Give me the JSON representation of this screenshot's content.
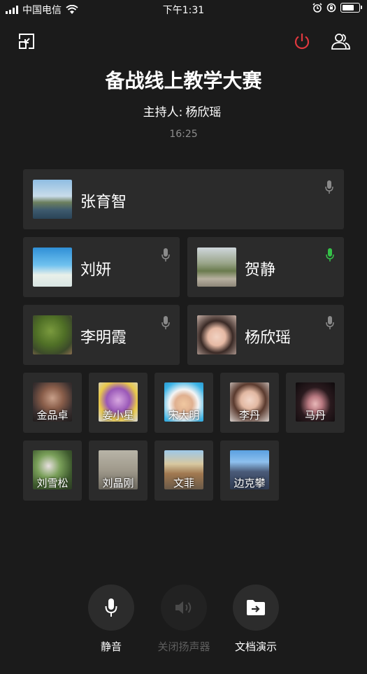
{
  "status_bar": {
    "carrier": "中国电信",
    "time": "下午1:31"
  },
  "meeting": {
    "title": "备战线上教学大赛",
    "host_label": "主持人:",
    "host_name": "杨欣瑶",
    "elapsed": "16:25"
  },
  "speakers": [
    {
      "name": "张育智",
      "mic": "muted"
    },
    {
      "name": "刘妍",
      "mic": "muted"
    },
    {
      "name": "贺静",
      "mic": "speaking"
    },
    {
      "name": "李明霞",
      "mic": "muted"
    },
    {
      "name": "杨欣瑶",
      "mic": "muted"
    }
  ],
  "attendees": [
    "金品卓",
    "姜小星",
    "宋大明",
    "李丹",
    "马丹",
    "刘雪松",
    "刘晶刚",
    "文菲",
    "边克攀"
  ],
  "controls": [
    {
      "label": "静音",
      "icon": "microphone-icon",
      "enabled": true
    },
    {
      "label": "关闭扬声器",
      "icon": "speaker-icon",
      "enabled": false
    },
    {
      "label": "文档演示",
      "icon": "folder-share-icon",
      "enabled": true
    }
  ],
  "colors": {
    "background": "#1b1b1b",
    "card": "#2b2b2b",
    "hangup": "#e0383e",
    "speaking": "#35c148",
    "muted_mic": "#8a8a8a"
  }
}
